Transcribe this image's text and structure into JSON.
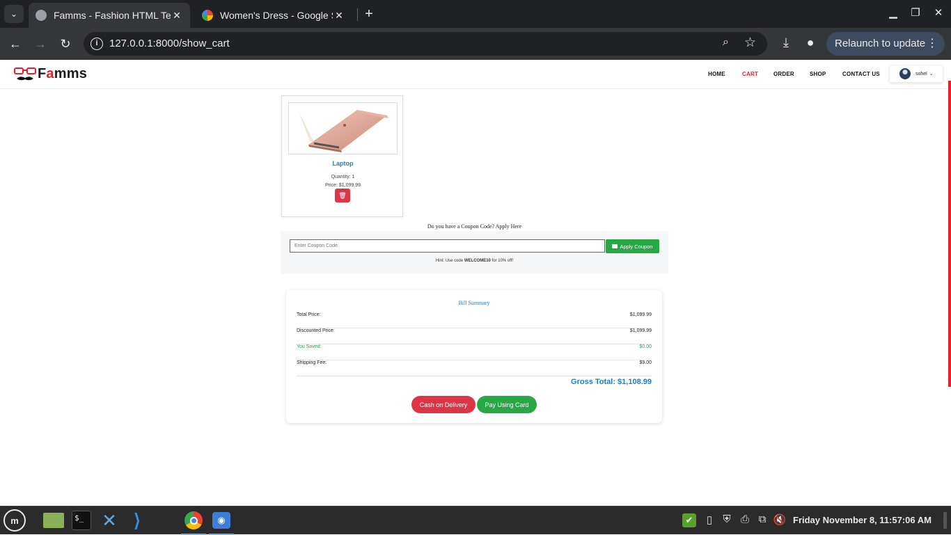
{
  "browser": {
    "tabs": [
      {
        "title": "Famms - Fashion HTML Temp",
        "active": true
      },
      {
        "title": "Women's Dress - Google Sea",
        "active": false
      }
    ],
    "url": "127.0.0.1:8000/show_cart",
    "relaunch_label": "Relaunch to update"
  },
  "site": {
    "brand_prefix": "F",
    "brand_accent": "a",
    "brand_suffix": "mms",
    "nav": [
      "HOME",
      "CART",
      "ORDER",
      "SHOP",
      "CONTACT US"
    ],
    "active_nav": "CART",
    "user_name": "sohel"
  },
  "cart": {
    "items": [
      {
        "name": "Laptop",
        "quantity_text": "Quantity: 1",
        "price_text": "Price: $1,099.99"
      }
    ]
  },
  "coupon": {
    "question": "Do you have a Coupon Code? Apply Here",
    "placeholder": "Enter Coupon Code",
    "apply_label": "Apply Coupon",
    "hint_prefix": "Hint: Use code ",
    "hint_code": "WELCOME10",
    "hint_suffix": " for 10% off!"
  },
  "bill": {
    "title": "Bill Summary",
    "rows": [
      {
        "label": "Total Price:",
        "value": "$1,099.99"
      },
      {
        "label": "Discounted Price:",
        "value": "$1,099.99"
      },
      {
        "label": "You Saved:",
        "value": "$0.00"
      },
      {
        "label": "Shipping Fee:",
        "value": "$9.00"
      }
    ],
    "gross_total": "Gross Total: $1,108.99",
    "cod_label": "Cash on Delivery",
    "card_label": "Pay Using Card"
  },
  "taskbar": {
    "clock": "Friday November  8, 11:57:06 AM"
  },
  "colors": {
    "accent_red": "#e91e28",
    "link_blue": "#1a7fc8",
    "success_green": "#28a745",
    "danger_red": "#dc3545"
  }
}
